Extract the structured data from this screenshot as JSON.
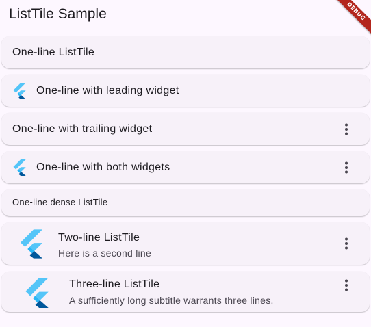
{
  "app_bar": {
    "title": "ListTile Sample",
    "debug_banner": "DEBUG"
  },
  "colors": {
    "background": "#fdf7ff",
    "card": "#f7f1f9",
    "title_text": "#1d1b20",
    "subtitle_text": "#49454f",
    "debug_banner": "#b3261e",
    "flutter_light": "#54c5f8",
    "flutter_dark": "#01579b",
    "flutter_mid": "#29b6f6"
  },
  "tiles": [
    {
      "title": "One-line ListTile",
      "leading_icon": null,
      "trailing_icon": null
    },
    {
      "title": "One-line with leading widget",
      "leading_icon": "flutter-logo-icon",
      "trailing_icon": null
    },
    {
      "title": "One-line with trailing widget",
      "leading_icon": null,
      "trailing_icon": "more-vert-icon"
    },
    {
      "title": "One-line with both widgets",
      "leading_icon": "flutter-logo-icon",
      "trailing_icon": "more-vert-icon"
    },
    {
      "title": "One-line dense ListTile",
      "dense": true,
      "leading_icon": null,
      "trailing_icon": null
    },
    {
      "title": "Two-line ListTile",
      "subtitle": "Here is a second line",
      "leading_icon": "flutter-logo-icon",
      "trailing_icon": "more-vert-icon"
    },
    {
      "title": "Three-line ListTile",
      "subtitle": "A sufficiently long subtitle warrants three lines.",
      "leading_icon": "flutter-logo-icon",
      "trailing_icon": "more-vert-icon"
    }
  ]
}
